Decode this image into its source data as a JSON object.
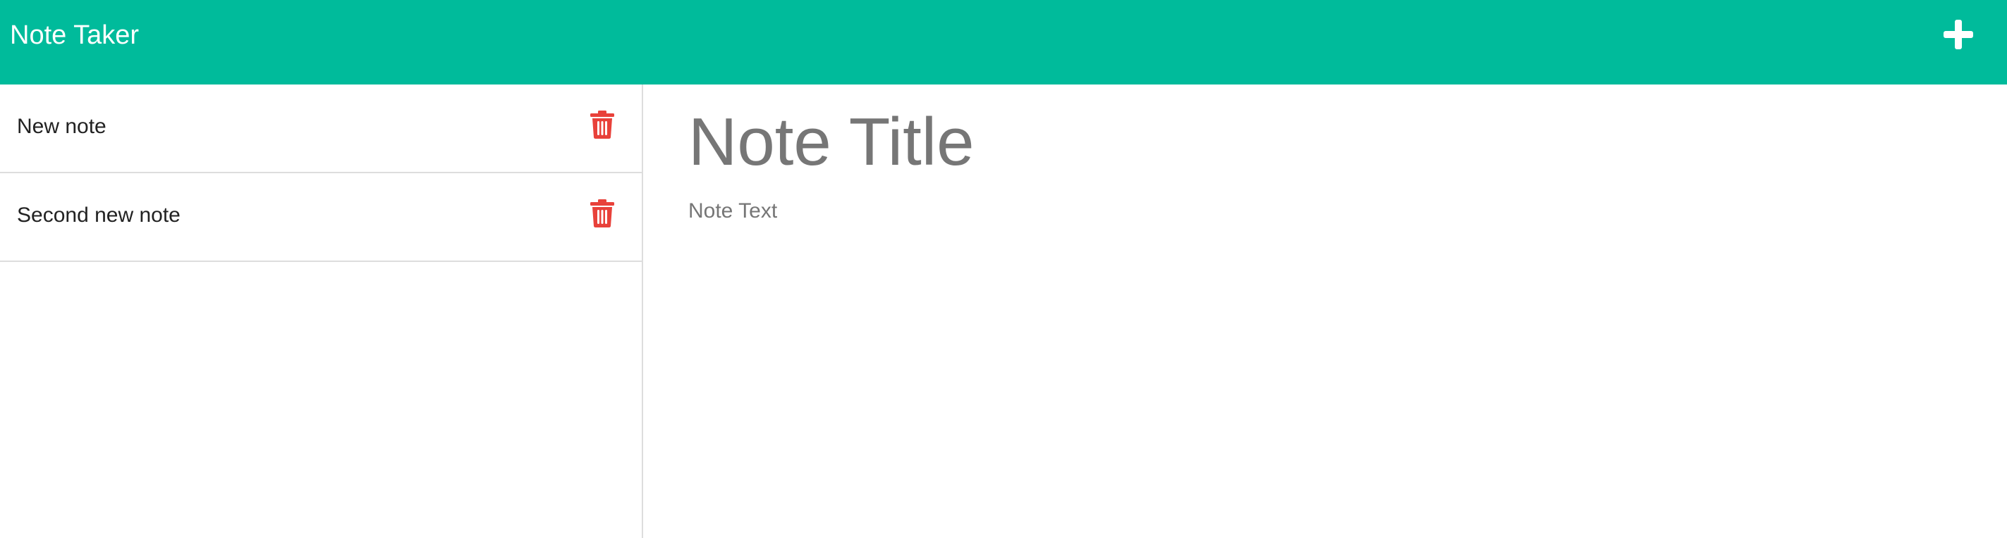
{
  "header": {
    "brand": "Note Taker",
    "new_note_icon": "plus-icon",
    "background_color": "#00BB9B"
  },
  "sidebar": {
    "notes": [
      {
        "title": "New note",
        "delete_icon": "trash-icon"
      },
      {
        "title": "Second new note",
        "delete_icon": "trash-icon"
      }
    ],
    "delete_color": "#E8413A"
  },
  "editor": {
    "title_placeholder": "Note Title",
    "text_placeholder": "Note Text"
  }
}
